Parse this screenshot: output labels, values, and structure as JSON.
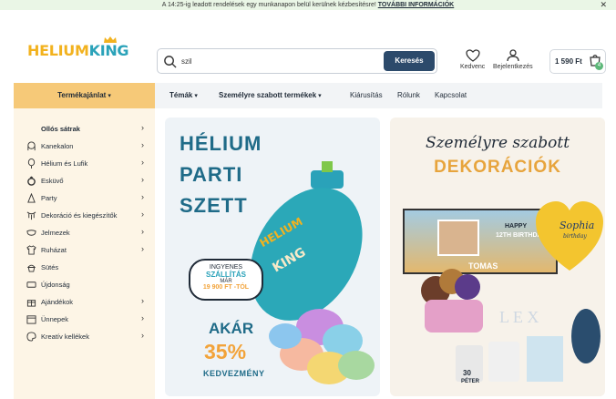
{
  "topbar": {
    "message": "A 14:25-ig leadott rendelések egy munkanapon belül kerülnek kézbesítésre!",
    "link": "TOVÁBBI INFORMÁCIÓK",
    "close": "✕"
  },
  "header": {
    "logo_part1": "HELIUM",
    "logo_part2": "KING",
    "search_value": "szil",
    "search_button": "Keresés",
    "wishlist_label": "Kedvenc",
    "login_label": "Bejelentkezés",
    "cart_total": "1 590 Ft",
    "cart_count": "4"
  },
  "nav": {
    "categories_button": "Termékajánlat",
    "items": [
      "Témák",
      "Személyre szabott termékek",
      "Kiárusítás",
      "Rólunk",
      "Kapcsolat"
    ]
  },
  "sidebar": {
    "items": [
      {
        "label": "Ollós sátrak",
        "icon": "none"
      },
      {
        "label": "Kanekalon",
        "icon": "wig-icon"
      },
      {
        "label": "Hélium és Lufik",
        "icon": "balloon-icon"
      },
      {
        "label": "Esküvő",
        "icon": "ring-icon"
      },
      {
        "label": "Party",
        "icon": "party-hat-icon"
      },
      {
        "label": "Dekoráció és kiegészítők",
        "icon": "decoration-icon"
      },
      {
        "label": "Jelmezek",
        "icon": "mask-icon"
      },
      {
        "label": "Ruházat",
        "icon": "shirt-icon"
      },
      {
        "label": "Sütés",
        "icon": "cupcake-icon"
      },
      {
        "label": "Újdonság",
        "icon": "new-tag-icon"
      },
      {
        "label": "Ajándékok",
        "icon": "gift-icon"
      },
      {
        "label": "Ünnepek",
        "icon": "calendar-icon"
      },
      {
        "label": "Kreatív kellékek",
        "icon": "palette-icon"
      }
    ]
  },
  "banner1": {
    "title_lines": [
      "HÉLIUM",
      "PARTI",
      "SZETT"
    ],
    "bubble_line1": "INGYENES",
    "bubble_line2": "SZÁLLÍTÁS",
    "bubble_line3": "MÁR",
    "bubble_line4": "19 900 FT -TÓL",
    "akar": "AKÁR",
    "percent": "35%",
    "discount": "KEDVEZMÉNY",
    "tank_brand": "HELIUM KING"
  },
  "banner2": {
    "title1": "Személyre szabott",
    "title2": "DEKORÁCIÓK",
    "happy": "HAPPY",
    "birthday": "12TH BIRTHDAY",
    "name": "TOMAS",
    "balloon_name": "Sophia",
    "balloon_sub": "birthday",
    "cup_number": "30",
    "cup_name": "PÉTER"
  },
  "colors": {
    "accent_orange": "#f6c978",
    "brand_teal": "#2aa2b9",
    "search_button": "#2c4a6b",
    "sidebar_bg": "#fdf5e6"
  }
}
